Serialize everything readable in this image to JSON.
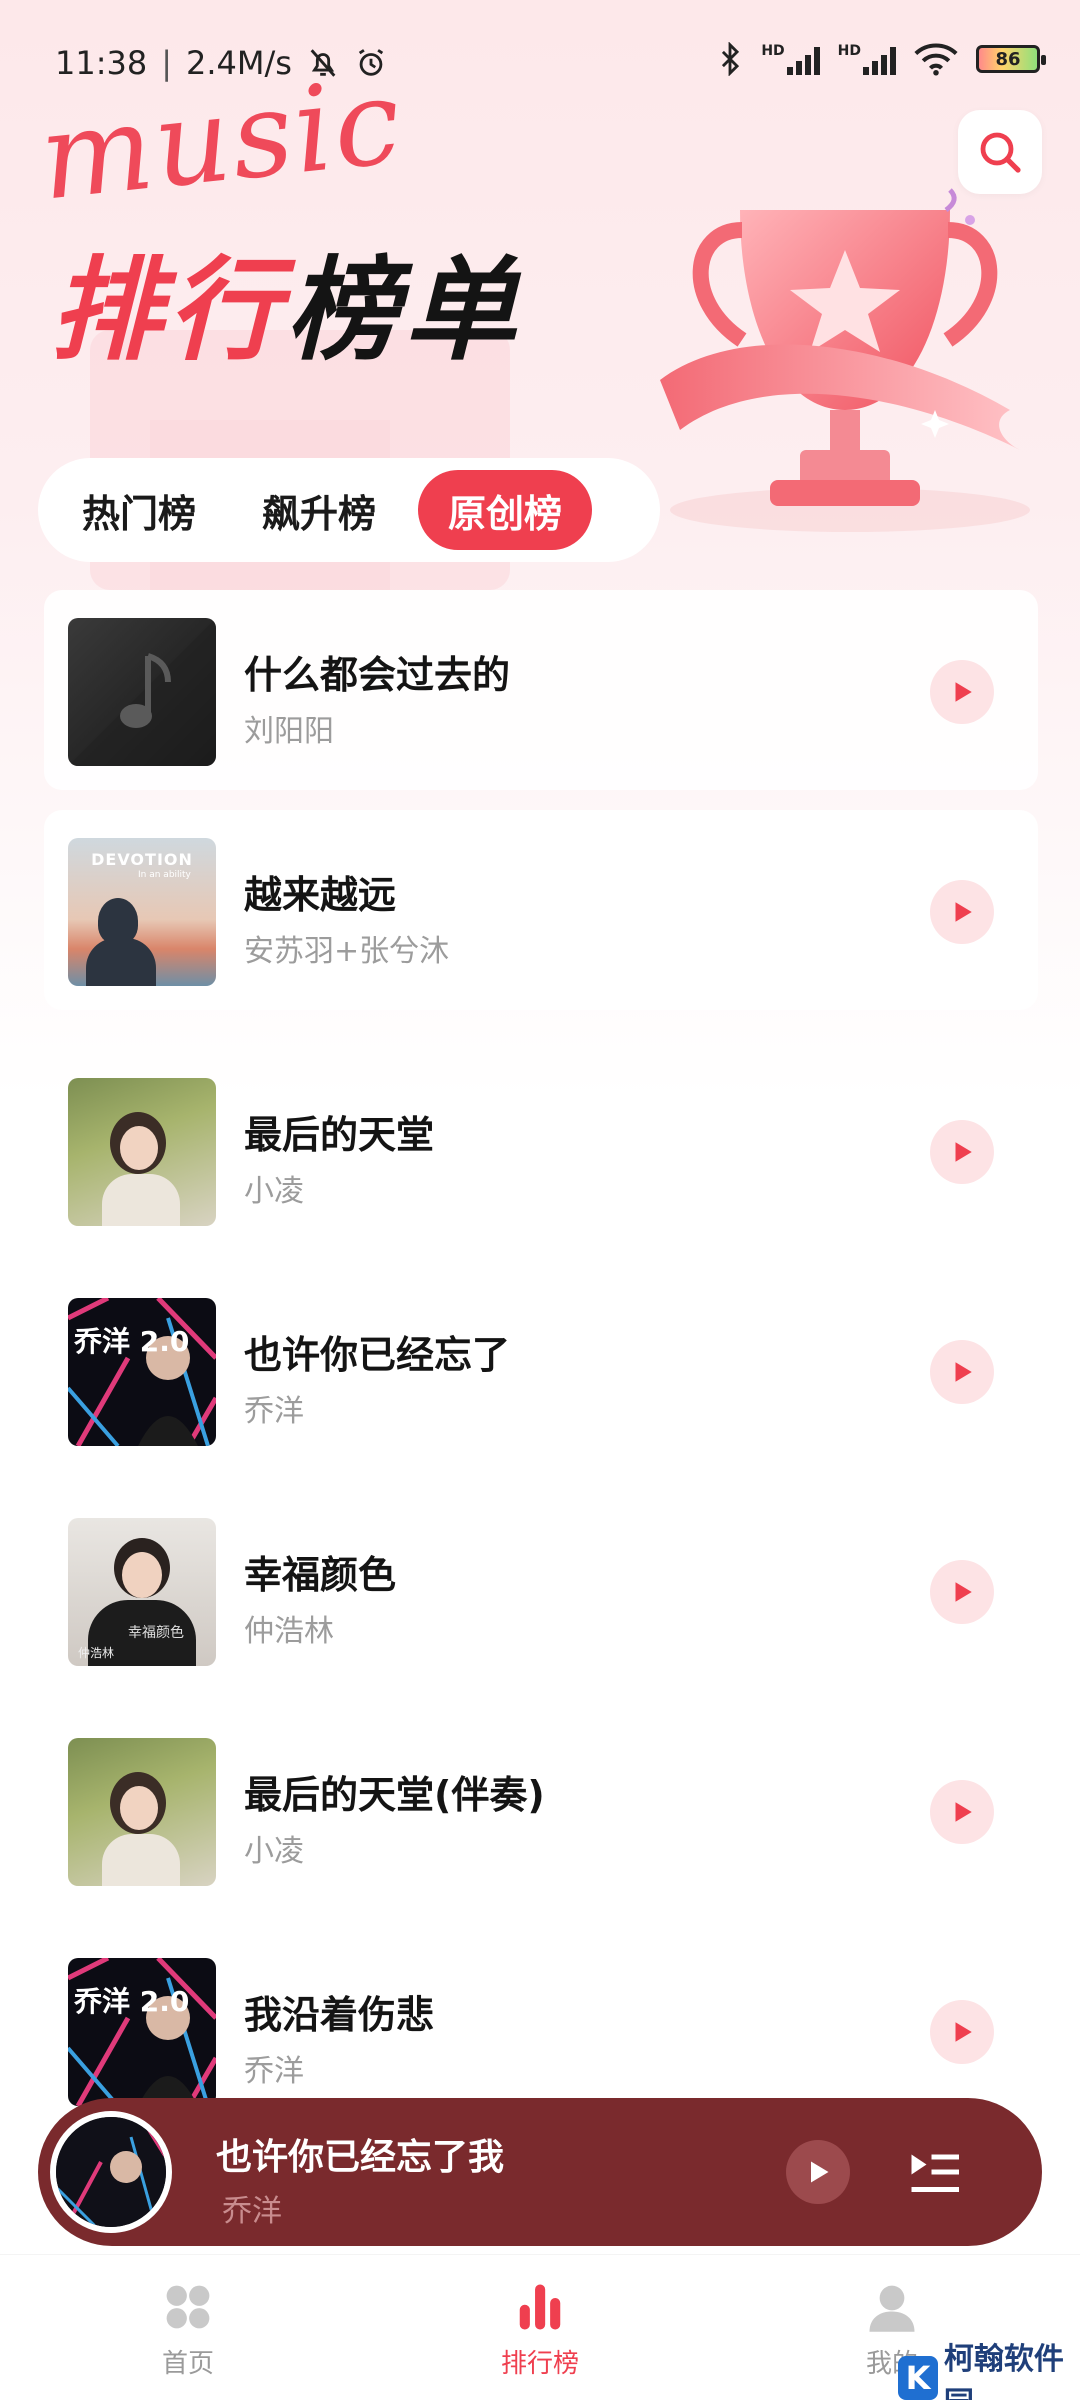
{
  "status_bar": {
    "time": "11:38",
    "speed": "2.4M/s",
    "battery": "86",
    "signal_label": "HD"
  },
  "header": {
    "logo": "music",
    "title_part1": "排行",
    "title_part2": "榜单"
  },
  "tabs": [
    {
      "label": "热门榜",
      "active": false
    },
    {
      "label": "飙升榜",
      "active": false
    },
    {
      "label": "原创榜",
      "active": true
    }
  ],
  "songs": [
    {
      "title": "什么都会过去的",
      "artist": "刘阳阳",
      "cover": "music-note-cover"
    },
    {
      "title": "越来越远",
      "artist": "安苏羽+张兮沐",
      "cover_text": "DEVOTION",
      "cover_sub": "In an ability"
    },
    {
      "title": "最后的天堂",
      "artist": "小凌",
      "cover": "portrait-cover"
    },
    {
      "title": "也许你已经忘了",
      "artist": "乔洋",
      "cover_text": "乔洋 2.0"
    },
    {
      "title": "幸福颜色",
      "artist": "仲浩林",
      "cover_text": "幸福颜色",
      "cover_sub": "仲浩林"
    },
    {
      "title": "最后的天堂(伴奏)",
      "artist": "小凌",
      "cover": "portrait-cover"
    },
    {
      "title": "我沿着伤悲",
      "artist": "乔洋",
      "cover_text": "乔洋 2.0"
    }
  ],
  "mini_player": {
    "title": "也许你已经忘了我",
    "artist": "乔洋"
  },
  "bottom_nav": [
    {
      "label": "首页",
      "icon": "home-grid-icon",
      "active": false
    },
    {
      "label": "排行榜",
      "icon": "chart-bars-icon",
      "active": true
    },
    {
      "label": "我的",
      "icon": "user-icon",
      "active": false
    }
  ],
  "watermark": {
    "text": "柯翰软件园"
  },
  "colors": {
    "accent": "#ef3f4f",
    "player_bg": "#7a2a2d"
  }
}
